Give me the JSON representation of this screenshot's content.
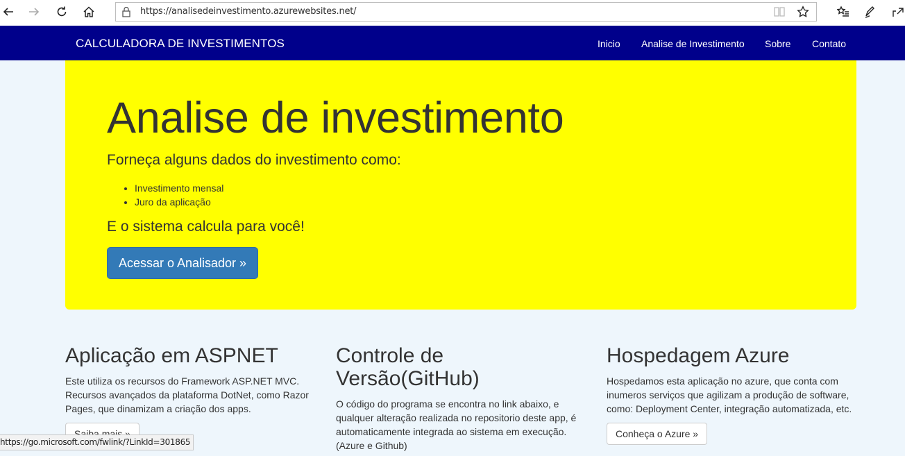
{
  "browser": {
    "url": "https://analisedeinvestimento.azurewebsites.net/",
    "status_url": "https://go.microsoft.com/fwlink/?LinkId=301865"
  },
  "navbar": {
    "brand": "CALCULADORA DE INVESTIMENTOS",
    "links": [
      "Inicio",
      "Analise de Investimento",
      "Sobre",
      "Contato"
    ],
    "bg_color": "#00008b"
  },
  "jumbotron": {
    "title": "Analise de investimento",
    "lead": "Forneça alguns dados do investimento como:",
    "items": [
      "Investimento mensal",
      "Juro da aplicação"
    ],
    "lead2": "E o sistema calcula para você!",
    "button": "Acessar o Analisador »",
    "bg_color": "#ffff00"
  },
  "columns": [
    {
      "title": "Aplicação em ASPNET",
      "text": "Este utiliza os recursos do Framework ASP.NET MVC. Recursos avançados da plataforma DotNet, como Razor Pages, que dinamizam a criação dos apps.",
      "button": "Saiba mais »"
    },
    {
      "title": "Controle de Versão(GitHub)",
      "text": "O código do programa se encontra no link abaixo, e qualquer alteração realizada no repositorio deste app, é automaticamente integrada ao sistema em execução.(Azure e Github)",
      "button": ""
    },
    {
      "title": "Hospedagem Azure",
      "text": "Hospedamos esta aplicação no azure, que conta com inumeros serviços que agilizam a produção de software, como: Deployment Center, integração automatizada, etc.",
      "button": "Conheça o Azure »"
    }
  ]
}
